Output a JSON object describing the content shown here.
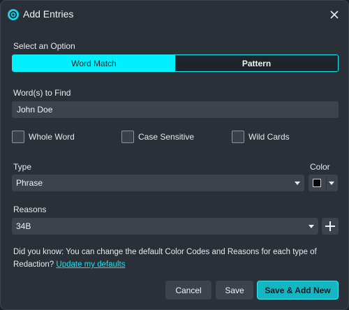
{
  "dialog": {
    "title": "Add Entries",
    "app_icon": "logo-icon",
    "close_icon": "close-icon"
  },
  "option": {
    "label": "Select an Option",
    "tabs": [
      {
        "label": "Word Match",
        "active": true
      },
      {
        "label": "Pattern",
        "active": false
      }
    ]
  },
  "find": {
    "label": "Word(s) to Find",
    "value": "John  Doe"
  },
  "options": {
    "whole_word": {
      "label": "Whole Word",
      "checked": false
    },
    "case_sensitive": {
      "label": "Case Sensitive",
      "checked": false
    },
    "wild_cards": {
      "label": "Wild Cards",
      "checked": false
    }
  },
  "type": {
    "label": "Type",
    "value": "Phrase"
  },
  "color": {
    "label": "Color",
    "value": "#000000"
  },
  "reasons": {
    "label": "Reasons",
    "value": "34B",
    "add_icon": "plus-icon"
  },
  "info": {
    "text": "Did you know: You can change the default Color Codes and Reasons for each type of Redaction?",
    "link": "Update my defaults"
  },
  "buttons": {
    "cancel": "Cancel",
    "save": "Save",
    "save_add_new": "Save & Add New"
  },
  "colors": {
    "accent": "#00f0ff",
    "background": "#2a3038",
    "field": "#3c434d",
    "primary_button": "#15b6c3"
  }
}
